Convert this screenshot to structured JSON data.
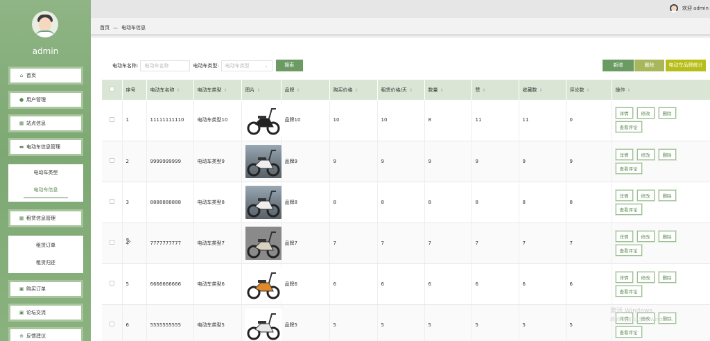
{
  "user": {
    "name": "admin",
    "welcome": "欢迎 admin"
  },
  "sidebar": {
    "items": [
      {
        "label": "首页",
        "icon": "home-icon"
      },
      {
        "label": "用户管理",
        "icon": "user-icon"
      },
      {
        "label": "站点信息",
        "icon": "grid-icon"
      },
      {
        "label": "电动车信息管理",
        "icon": "car-icon"
      }
    ],
    "sub1": [
      {
        "label": "电动车类型"
      },
      {
        "label": "电动车信息"
      }
    ],
    "item5": {
      "label": "租赁信息管理",
      "icon": "grid-icon"
    },
    "sub2": [
      {
        "label": "租赁订单"
      },
      {
        "label": "租赁归还"
      }
    ],
    "tail": [
      {
        "label": "购买订单",
        "icon": "doc-icon"
      },
      {
        "label": "论坛交流",
        "icon": "doc-icon"
      },
      {
        "label": "反馈建议",
        "icon": "plus-icon"
      }
    ]
  },
  "breadcrumb": {
    "home": "首页",
    "sep": "—",
    "current": "电动车信息"
  },
  "search": {
    "name_label": "电动车名称:",
    "name_placeholder": "电动车名称",
    "type_label": "电动车类型:",
    "type_placeholder": "电动车类型",
    "search_btn": "搜索"
  },
  "actions": {
    "add": "新增",
    "delete": "删除",
    "stats": "电动车品牌统计"
  },
  "table": {
    "headers": [
      "序号",
      "电动车名称",
      "电动车类型",
      "图片",
      "品牌",
      "购买价格",
      "租赁价格/天",
      "数量",
      "赞",
      "收藏数",
      "评论数",
      "操作"
    ],
    "rows": [
      {
        "no": "1",
        "name": "11111111110",
        "type": "电动车类型10",
        "brand": "品牌10",
        "price": "10",
        "rent": "10",
        "qty": "8",
        "like": "11",
        "fav": "11",
        "comment": "0"
      },
      {
        "no": "2",
        "name": "9999999999",
        "type": "电动车类型9",
        "brand": "品牌9",
        "price": "9",
        "rent": "9",
        "qty": "9",
        "like": "9",
        "fav": "9",
        "comment": "9"
      },
      {
        "no": "3",
        "name": "8888888888",
        "type": "电动车类型8",
        "brand": "品牌8",
        "price": "8",
        "rent": "8",
        "qty": "8",
        "like": "8",
        "fav": "8",
        "comment": "8"
      },
      {
        "no": "4",
        "name": "7777777777",
        "type": "电动车类型7",
        "brand": "品牌7",
        "price": "7",
        "rent": "7",
        "qty": "7",
        "like": "7",
        "fav": "7",
        "comment": "7"
      },
      {
        "no": "5",
        "name": "6666666666",
        "type": "电动车类型6",
        "brand": "品牌6",
        "price": "6",
        "rent": "6",
        "qty": "6",
        "like": "6",
        "fav": "6",
        "comment": "6"
      },
      {
        "no": "6",
        "name": "5555555555",
        "type": "电动车类型5",
        "brand": "品牌5",
        "price": "5",
        "rent": "5",
        "qty": "5",
        "like": "5",
        "fav": "5",
        "comment": "5"
      }
    ],
    "op_labels": {
      "detail": "详情",
      "edit": "修改",
      "delete": "删除",
      "comments": "查看评论"
    }
  },
  "watermark": {
    "line1": "激活 Windows",
    "line2": "转到\"设置\"以激活 Windows。"
  }
}
